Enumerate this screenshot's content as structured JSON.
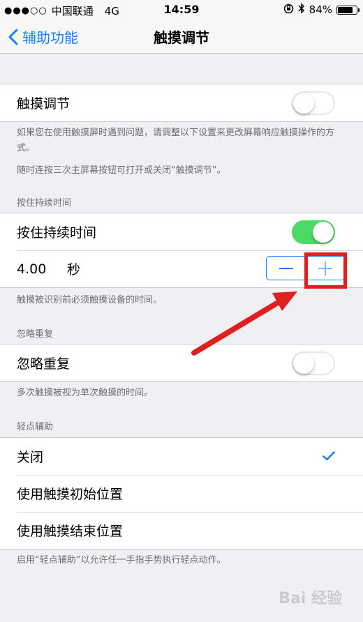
{
  "status_bar": {
    "signal": "●●●○○",
    "carrier": "中国联通",
    "network": "4G",
    "time": "14:59",
    "battery_percent": "84%",
    "battery_level": 0.84,
    "icons": [
      "orientation-lock-icon",
      "bluetooth-icon",
      "battery-icon"
    ]
  },
  "nav": {
    "back_label": "辅助功能",
    "title": "触摸调节"
  },
  "touch_accommodations": {
    "label": "触摸调节",
    "enabled": false,
    "footer_1": "如果您在使用触摸屏时遇到问题，请调整以下设置来更改屏幕响应触摸操作的方式。",
    "footer_2": "随时连按三次主屏幕按钮可打开或关闭“触摸调节”。"
  },
  "hold_duration": {
    "header": "按住持续时间",
    "label": "按住持续时间",
    "enabled": true,
    "value": "4.00",
    "unit": "秒",
    "footer": "触摸被识别前必须触摸设备的时间。"
  },
  "ignore_repeat": {
    "header": "忽略重复",
    "label": "忽略重复",
    "enabled": false,
    "footer": "多次触摸被视为单次触摸的时间。"
  },
  "tap_assistance": {
    "header": "轻点辅助",
    "options": [
      {
        "label": "关闭",
        "selected": true
      },
      {
        "label": "使用触摸初始位置",
        "selected": false
      },
      {
        "label": "使用触摸结束位置",
        "selected": false
      }
    ],
    "footer": "启用“轻点辅助”以允许任一手指手势执行轻点动作。"
  },
  "watermark": "Bai 经验",
  "colors": {
    "accent": "#147efb",
    "switch_on": "#4cd964",
    "annotation": "#e02020",
    "background": "#efeff4"
  }
}
